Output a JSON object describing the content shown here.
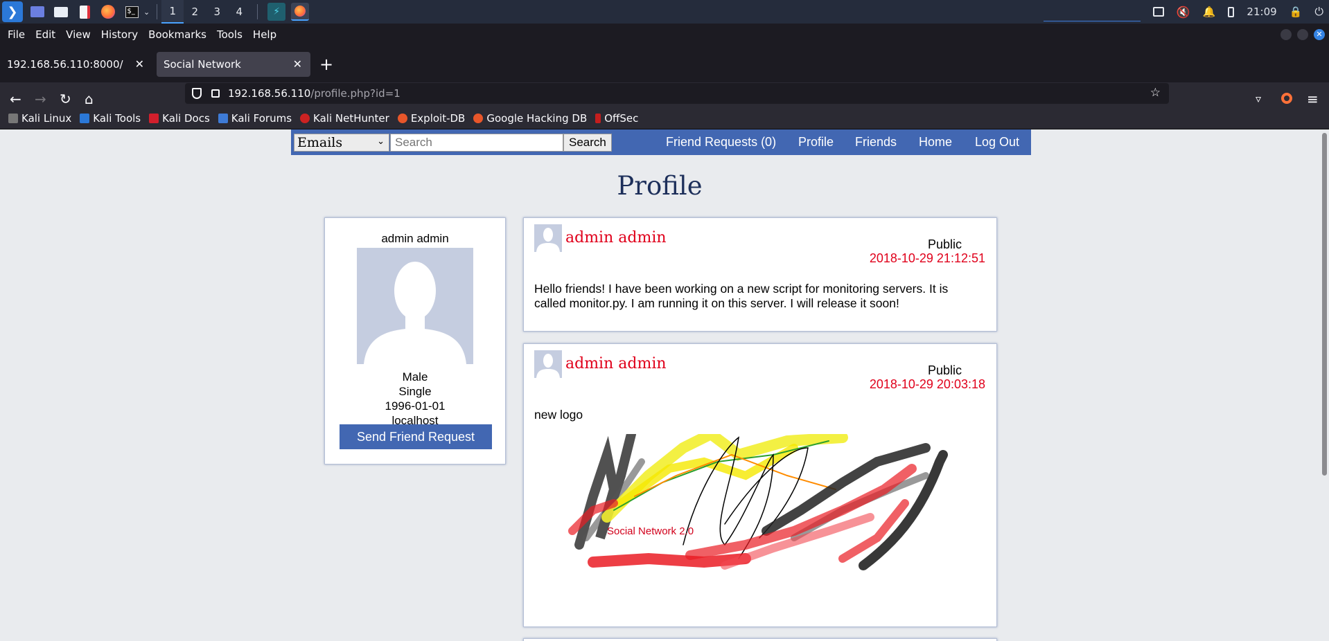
{
  "taskbar": {
    "workspaces": [
      "1",
      "2",
      "3",
      "4"
    ],
    "active_workspace": "1",
    "clock": "21:09",
    "icons": [
      "kali-menu-icon",
      "terminal-window-icon",
      "file-manager-icon",
      "text-editor-icon",
      "firefox-icon",
      "terminal-icon"
    ],
    "tray_icons": [
      "display-icon",
      "mute-icon",
      "bell-icon",
      "battery-icon",
      "lock-icon",
      "power-icon"
    ]
  },
  "browser": {
    "menu": [
      "File",
      "Edit",
      "View",
      "History",
      "Bookmarks",
      "Tools",
      "Help"
    ],
    "tabs": [
      {
        "title": "192.168.56.110:8000/",
        "selected": false
      },
      {
        "title": "Social Network",
        "selected": true
      }
    ],
    "url_host": "192.168.56.110",
    "url_path": "/profile.php?id=1",
    "bookmarks": [
      "Kali Linux",
      "Kali Tools",
      "Kali Docs",
      "Kali Forums",
      "Kali NetHunter",
      "Exploit-DB",
      "Google Hacking DB",
      "OffSec"
    ]
  },
  "site": {
    "search_type": "Emails",
    "search_placeholder": "Search",
    "search_button": "Search",
    "nav_links": [
      "Friend Requests (0)",
      "Profile",
      "Friends",
      "Home",
      "Log Out"
    ],
    "page_title": "Profile"
  },
  "profile": {
    "name": "admin admin",
    "gender": "Male",
    "status": "Single",
    "birthdate": "1996-01-01",
    "location": "localhost",
    "button": "Send Friend Request"
  },
  "posts": [
    {
      "author": "admin admin",
      "visibility": "Public",
      "time": "2018-10-29 21:12:51",
      "body": "Hello friends! I have been working on a new script for monitoring servers. It is called monitor.py. I am running it on this server. I will release it soon!"
    },
    {
      "author": "admin admin",
      "visibility": "Public",
      "time": "2018-10-29 20:03:18",
      "body": "new logo",
      "image_caption": "Social Network 2.0"
    }
  ],
  "colors": {
    "site_blue": "#4267b2",
    "author_red": "#e0001b",
    "page_bg": "#e9ebee"
  }
}
